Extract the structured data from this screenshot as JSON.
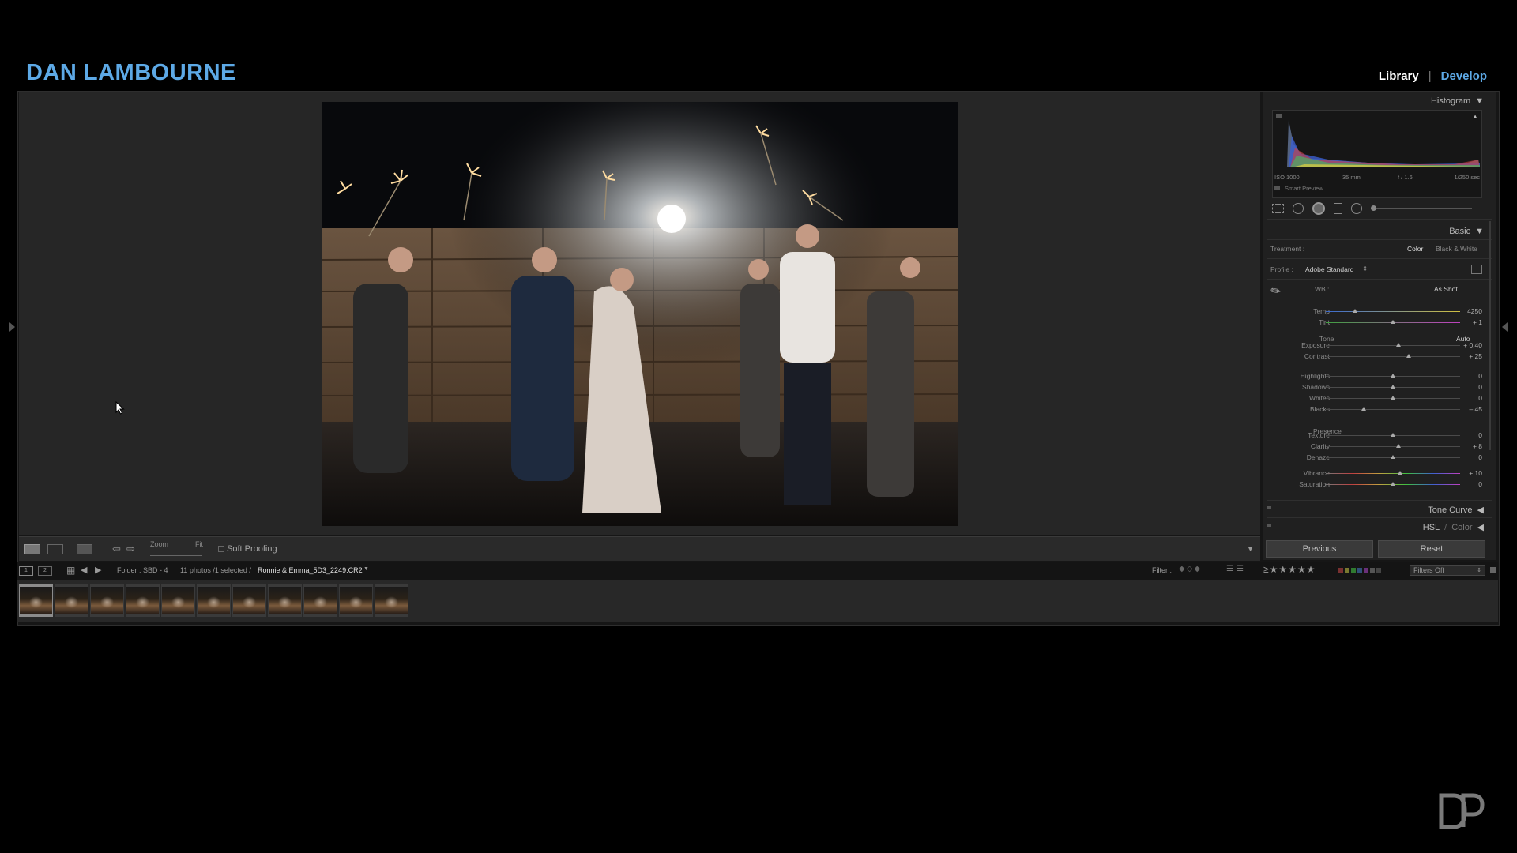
{
  "brand": {
    "title": "DAN LAMBOURNE"
  },
  "modules": {
    "library": "Library",
    "develop": "Develop"
  },
  "toolbar": {
    "zoom_label": "Zoom",
    "fit_label": "Fit",
    "soft_proofing": "Soft Proofing"
  },
  "panel": {
    "histogram": {
      "title": "Histogram",
      "iso": "ISO 1000",
      "focal": "35 mm",
      "aperture": "f / 1.6",
      "shutter": "1/250 sec",
      "smart_preview": "Smart Preview"
    },
    "basic": {
      "title": "Basic",
      "treatment_label": "Treatment :",
      "treatment_color": "Color",
      "treatment_bw": "Black & White",
      "profile_label": "Profile :",
      "profile_value": "Adobe Standard",
      "wb_label": "WB :",
      "wb_value": "As Shot",
      "tone_label": "Tone",
      "auto_label": "Auto",
      "presence_label": "Presence",
      "sliders": [
        {
          "label": "Temp",
          "value": "4250",
          "pos": 0.22
        },
        {
          "label": "Tint",
          "value": "+ 1",
          "pos": 0.5
        },
        {
          "label": "Exposure",
          "value": "+ 0.40",
          "pos": 0.54
        },
        {
          "label": "Contrast",
          "value": "+ 25",
          "pos": 0.62
        },
        {
          "label": "Highlights",
          "value": "0",
          "pos": 0.5
        },
        {
          "label": "Shadows",
          "value": "0",
          "pos": 0.5
        },
        {
          "label": "Whites",
          "value": "0",
          "pos": 0.5
        },
        {
          "label": "Blacks",
          "value": "– 45",
          "pos": 0.28
        },
        {
          "label": "Texture",
          "value": "0",
          "pos": 0.5
        },
        {
          "label": "Clarity",
          "value": "+ 8",
          "pos": 0.54
        },
        {
          "label": "Dehaze",
          "value": "0",
          "pos": 0.5
        },
        {
          "label": "Vibrance",
          "value": "+ 10",
          "pos": 0.55
        },
        {
          "label": "Saturation",
          "value": "0",
          "pos": 0.5
        }
      ]
    },
    "tone_curve": "Tone Curve",
    "hsl": "HSL",
    "hsl_sep": "/",
    "color": "Color",
    "previous": "Previous",
    "reset": "Reset"
  },
  "filmbar": {
    "view1": "1",
    "view2": "2",
    "folder": "Folder : SBD - 4",
    "count": "11 photos /1 selected /",
    "filename": "Ronnie & Emma_5D3_2249.CR2",
    "filter_label": "Filter :",
    "filters_off": "Filters Off"
  },
  "filmstrip": {
    "count": 11,
    "selected_index": 0
  },
  "colors": {
    "accent": "#5da9e6",
    "panel_bg": "#202020"
  }
}
